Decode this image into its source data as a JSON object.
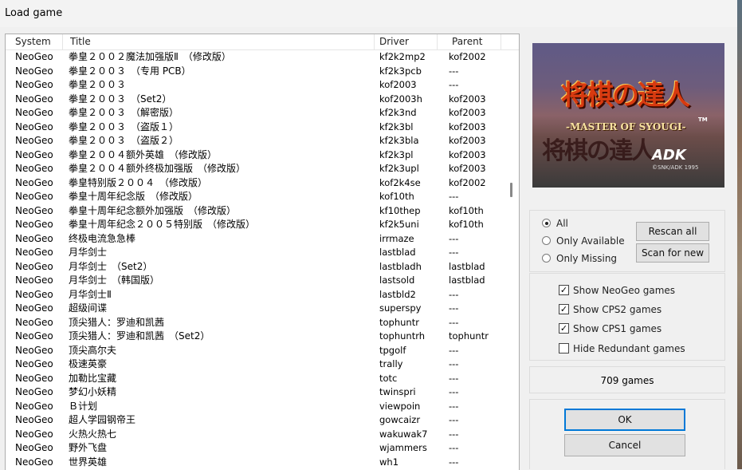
{
  "window": {
    "title": "Load game"
  },
  "columns": {
    "system": "System",
    "title": "Title",
    "driver": "Driver",
    "parent": "Parent"
  },
  "rows": [
    [
      "NeoGeo",
      "拳皇２００２魔法加强版Ⅱ　（修改版）",
      "kf2k2mp2",
      "kof2002"
    ],
    [
      "NeoGeo",
      "拳皇２００３　（专用 PCB）",
      "kf2k3pcb",
      "---"
    ],
    [
      "NeoGeo",
      "拳皇２００３",
      "kof2003",
      "---"
    ],
    [
      "NeoGeo",
      "拳皇２００３　（Set2）",
      "kof2003h",
      "kof2003"
    ],
    [
      "NeoGeo",
      "拳皇２００３　（解密版）",
      "kf2k3nd",
      "kof2003"
    ],
    [
      "NeoGeo",
      "拳皇２００３　（盗版１）",
      "kf2k3bl",
      "kof2003"
    ],
    [
      "NeoGeo",
      "拳皇２００３　（盗版２）",
      "kf2k3bla",
      "kof2003"
    ],
    [
      "NeoGeo",
      "拳皇２００４额外英雄　（修改版）",
      "kf2k3pl",
      "kof2003"
    ],
    [
      "NeoGeo",
      "拳皇２００４额外终极加强版　（修改版）",
      "kf2k3upl",
      "kof2003"
    ],
    [
      "NeoGeo",
      "拳皇特别版２００４　（修改版）",
      "kof2k4se",
      "kof2002"
    ],
    [
      "NeoGeo",
      "拳皇十周年纪念版　（修改版）",
      "kof10th",
      "---"
    ],
    [
      "NeoGeo",
      "拳皇十周年纪念额外加强版　（修改版）",
      "kf10thep",
      "kof10th"
    ],
    [
      "NeoGeo",
      "拳皇十周年纪念２００５特别版　（修改版）",
      "kf2k5uni",
      "kof10th"
    ],
    [
      "NeoGeo",
      "终极电流急急棒",
      "irrmaze",
      "---"
    ],
    [
      "NeoGeo",
      "月华剑士",
      "lastblad",
      "---"
    ],
    [
      "NeoGeo",
      "月华剑士　（Set2）",
      "lastbladh",
      "lastblad"
    ],
    [
      "NeoGeo",
      "月华剑士　（韩国版）",
      "lastsold",
      "lastblad"
    ],
    [
      "NeoGeo",
      "月华剑士Ⅱ",
      "lastbld2",
      "---"
    ],
    [
      "NeoGeo",
      "超级间谍",
      "superspy",
      "---"
    ],
    [
      "NeoGeo",
      "顶尖猎人：罗迪和凯茜",
      "tophuntr",
      "---"
    ],
    [
      "NeoGeo",
      "顶尖猎人：罗迪和凯茜　（Set2）",
      "tophuntrh",
      "tophuntr"
    ],
    [
      "NeoGeo",
      "顶尖高尔夫",
      "tpgolf",
      "---"
    ],
    [
      "NeoGeo",
      "极速英豪",
      "trally",
      "---"
    ],
    [
      "NeoGeo",
      "加勒比宝藏",
      "totc",
      "---"
    ],
    [
      "NeoGeo",
      "梦幻小妖精",
      "twinspri",
      "---"
    ],
    [
      "NeoGeo",
      "Ｂ计划",
      "viewpoin",
      "---"
    ],
    [
      "NeoGeo",
      "超人学园钢帝王",
      "gowcaizr",
      "---"
    ],
    [
      "NeoGeo",
      "火热火热七",
      "wakuwak7",
      "---"
    ],
    [
      "NeoGeo",
      "野外飞盘",
      "wjammers",
      "---"
    ],
    [
      "NeoGeo",
      "世界英雄",
      "wh1",
      "---"
    ]
  ],
  "preview": {
    "title": "将棋の達人",
    "subtitle": "-MASTER OF SYOUGI-",
    "tm": "TM",
    "ghost": "将棋の達人",
    "logo": "ADK",
    "copyright": "©SNK/ADK 1995"
  },
  "filter": {
    "all": "All",
    "only_available": "Only Available",
    "only_missing": "Only Missing",
    "selected": "all"
  },
  "buttons": {
    "rescan_all": "Rescan all",
    "scan_for_new": "Scan for new",
    "ok": "OK",
    "cancel": "Cancel"
  },
  "options": {
    "neogeo": {
      "label": "Show NeoGeo games",
      "checked": true
    },
    "cps2": {
      "label": "Show CPS2 games",
      "checked": true
    },
    "cps1": {
      "label": "Show CPS1 games",
      "checked": true
    },
    "hide_redundant": {
      "label": "Hide Redundant games",
      "checked": false
    }
  },
  "count": "709 games",
  "icons": {
    "check": "✓"
  }
}
